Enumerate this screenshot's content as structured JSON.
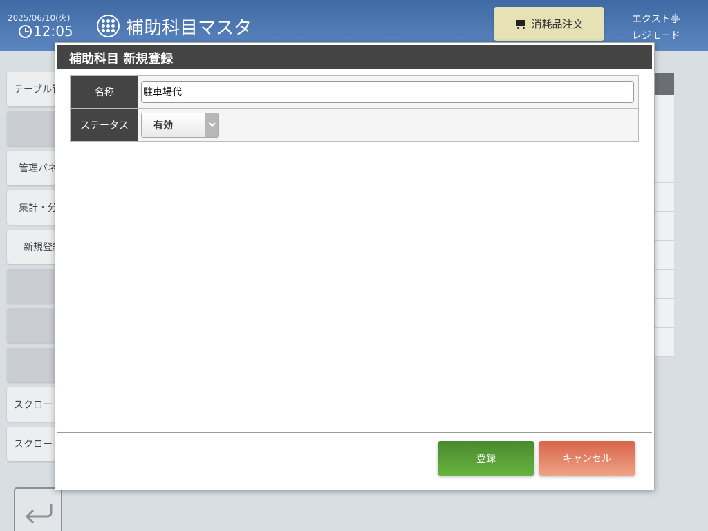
{
  "header": {
    "date": "2025/06/10(火)",
    "time": "12:05",
    "app_title": "補助科目マスタ",
    "order_button": "消耗品注文",
    "shop_name": "エクスト亭",
    "mode": "レジモード",
    "colors": {
      "header_bg": "#4a77b3",
      "order_button_bg": "#e6e2b6"
    }
  },
  "sidebar": {
    "items": [
      {
        "label": "テーブル管"
      },
      {
        "label": ""
      },
      {
        "label": "管理パネ"
      },
      {
        "label": "集計・分"
      },
      {
        "label": "新規登録"
      },
      {
        "label": ""
      },
      {
        "label": ""
      },
      {
        "label": ""
      },
      {
        "label": "スクロー"
      },
      {
        "label": "スクロー"
      }
    ]
  },
  "modal": {
    "title": "補助科目 新規登録",
    "fields": {
      "name_label": "名称",
      "name_value": "駐車場代",
      "status_label": "ステータス",
      "status_value": "有効"
    },
    "buttons": {
      "register": "登録",
      "cancel": "キャンセル"
    },
    "colors": {
      "register": "#58a035",
      "cancel": "#e28468",
      "title_bg": "#444444"
    }
  }
}
